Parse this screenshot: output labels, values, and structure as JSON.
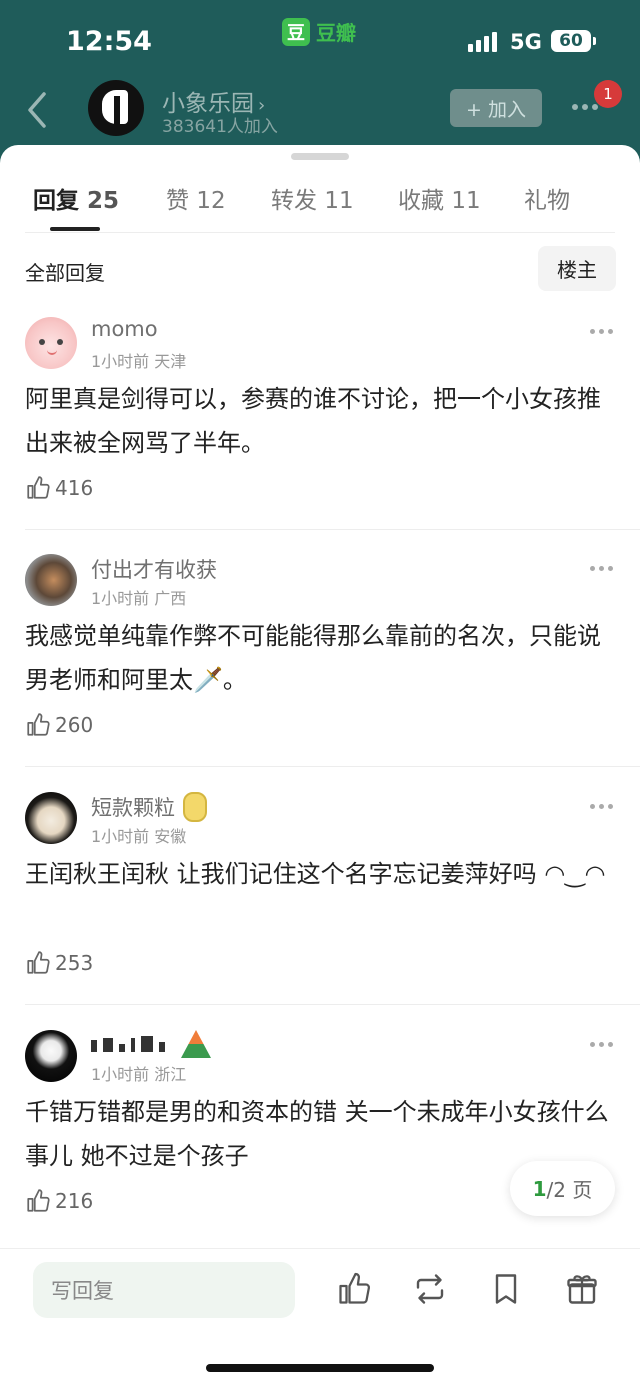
{
  "status_bar": {
    "time": "12:54",
    "app_name": "豆瓣",
    "app_logo_char": "豆",
    "network": "5G",
    "battery": "60"
  },
  "header": {
    "group_name": "小象乐园",
    "member_count": "383641人加入",
    "join_label": "+ 加入",
    "notification_count": "1"
  },
  "tabs": [
    {
      "label": "回复",
      "count": "25",
      "active": true
    },
    {
      "label": "赞",
      "count": "12"
    },
    {
      "label": "转发",
      "count": "11"
    },
    {
      "label": "收藏",
      "count": "11"
    },
    {
      "label": "礼物",
      "count": ""
    }
  ],
  "filter": {
    "label": "全部回复",
    "owner_button": "楼主"
  },
  "comments": [
    {
      "username": "momo",
      "time": "1小时前",
      "location": "天津",
      "text": "阿里真是剑得可以，参赛的谁不讨论，把一个小女孩推出来被全网骂了半年。",
      "likes": "416"
    },
    {
      "username": "付出才有收获",
      "time": "1小时前",
      "location": "广西",
      "text": "我感觉单纯靠作弊不可能能得那么靠前的名次，只能说男老师和阿里太🗡️。",
      "likes": "260"
    },
    {
      "username": "短款颗粒",
      "time": "1小时前",
      "location": "安徽",
      "text": "王闰秋王闰秋 让我们记住这个名字忘记姜萍好吗 ◠‿◠",
      "likes": "253"
    },
    {
      "username": "",
      "time": "1小时前",
      "location": "浙江",
      "text": "千错万错都是男的和资本的错 关一个未成年小女孩什么事儿 她不过是个孩子",
      "likes": "216"
    }
  ],
  "pager": {
    "current": "1",
    "total_text": "/2 页"
  },
  "bottom_bar": {
    "reply_placeholder": "写回复"
  },
  "icons": {
    "back": "chevron-left-icon",
    "like": "thumbs-up-icon",
    "repost": "repost-icon",
    "bookmark": "bookmark-icon",
    "gift": "gift-icon"
  }
}
